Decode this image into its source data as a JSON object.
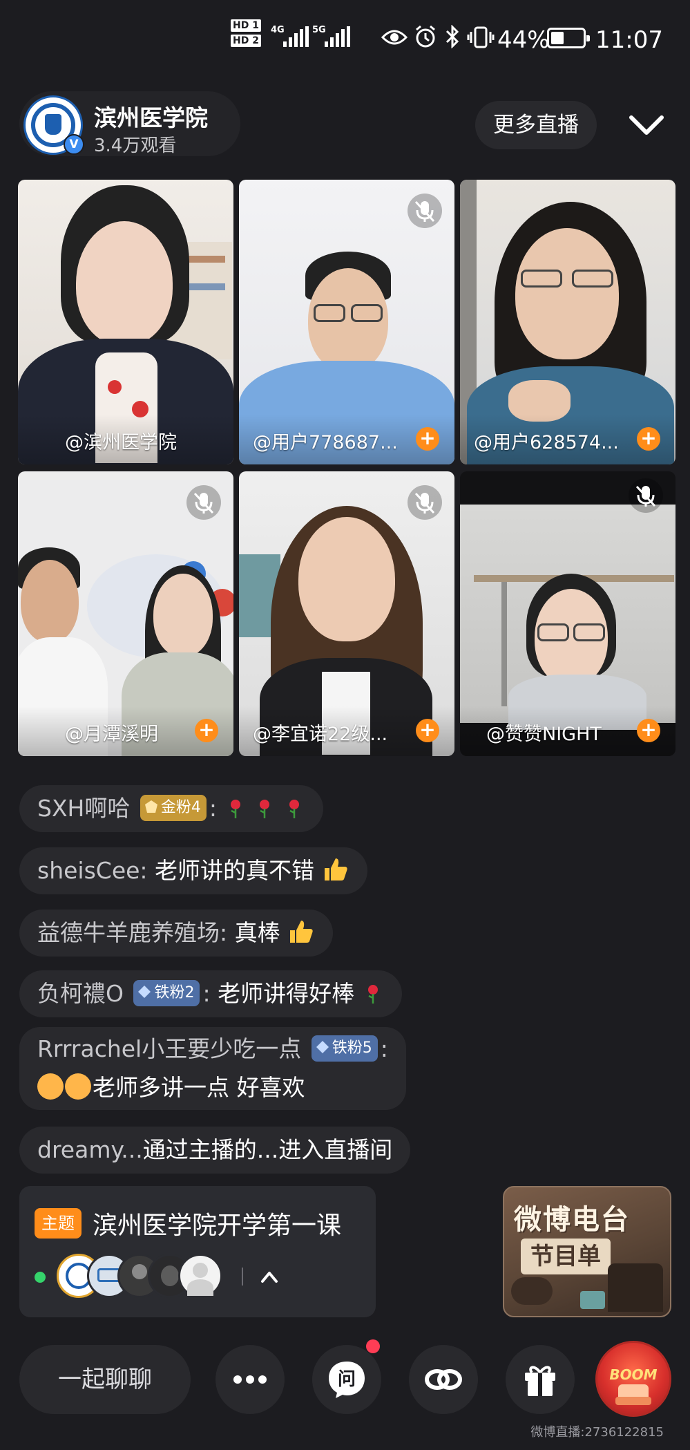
{
  "status_bar": {
    "hd1": "HD 1",
    "hd2": "HD 2",
    "net1": "4G",
    "net2": "5G",
    "battery_percent": "44%",
    "time": "11:07"
  },
  "header": {
    "host_name": "滨州医学院",
    "viewers": "3.4万观看",
    "more_live": "更多直播",
    "verified_mark": "V"
  },
  "video_tiles": [
    {
      "label": "@滨州医学院",
      "muted": false,
      "followable": false
    },
    {
      "label": "@用户778687...",
      "muted": true,
      "followable": true
    },
    {
      "label": "@用户628574...",
      "muted": false,
      "followable": true
    },
    {
      "label": "@月潭溪明",
      "muted": true,
      "followable": true
    },
    {
      "label": "@李宜诺22级...",
      "muted": true,
      "followable": true
    },
    {
      "label": "@赞赞NIGHT",
      "muted": true,
      "followable": true
    }
  ],
  "comments": [
    {
      "user": "SXH啊哈",
      "badge": "金粉4",
      "sep": ":",
      "message": ""
    },
    {
      "user": "sheisCee",
      "sep": ":",
      "message": "老师讲的真不错"
    },
    {
      "user": "益德牛羊鹿养殖场",
      "sep": ":",
      "message": "真棒"
    },
    {
      "user": "负柯禯O",
      "badge": "铁粉2",
      "sep": ":",
      "message": "老师讲得好棒"
    },
    {
      "user": "Rrrrachel小王要少吃一点",
      "badge": "铁粉5",
      "sep": ":",
      "message": "老师多讲一点 好喜欢"
    },
    {
      "user": "dreamy...",
      "message": "通过主播的...进入直播间"
    }
  ],
  "topic": {
    "tag": "主题",
    "title": "滨州医学院开学第一课"
  },
  "radio": {
    "title": "微博电台",
    "subtitle": "节目单"
  },
  "bottom_bar": {
    "chat_label": "一起聊聊",
    "ask_glyph": "问",
    "boom_label": "BOOM"
  },
  "watermark": "微博直播:2736122815",
  "colors": {
    "background": "#1c1c20",
    "accent_orange": "#ff8d1a",
    "online_green": "#35d46b",
    "gold_badge": "#c69937",
    "iron_badge": "#4f6fa6"
  }
}
